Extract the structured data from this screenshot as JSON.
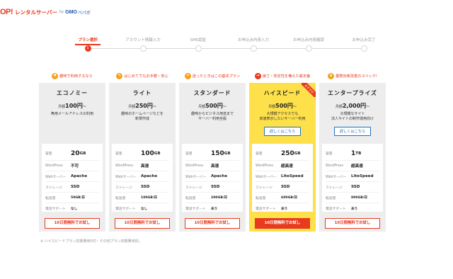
{
  "header": {
    "logo": "OP!",
    "name": "レンタルサーバー",
    "by": "by",
    "gmo": "GMO",
    "pepabo": "ペパボ"
  },
  "steps": [
    {
      "label": "プラン選択",
      "number": "1",
      "active": true
    },
    {
      "label": "アカウント情報入力",
      "number": "",
      "active": false
    },
    {
      "label": "SMS認証",
      "number": "",
      "active": false
    },
    {
      "label": "お申込み内容入力",
      "number": "",
      "active": false
    },
    {
      "label": "お申込み内容確認",
      "number": "",
      "active": false
    },
    {
      "label": "お申込み完了",
      "number": "",
      "active": false
    }
  ],
  "spec_labels": {
    "capacity": "容量",
    "wordpress": "WordPress",
    "webserver": "Webサーバー",
    "storage": "ストレージ",
    "transfer": "転送量",
    "support": "電話サポート"
  },
  "plans": [
    {
      "tagline": "趣味で利用するなら",
      "tag_icon": "¥",
      "name": "エコノミー",
      "price_prefix": "月額",
      "price": "100円",
      "price_suffix": "〜",
      "desc": "無用メールアドレスの利用",
      "capacity_num": "20",
      "capacity_unit": "GB",
      "wordpress": "不可",
      "webserver": "Apache",
      "storage": "SSD",
      "transfer": "50GB/日",
      "support": "なし",
      "trial": "10日間無料でお試し"
    },
    {
      "tagline": "はじめてでもお手軽・安心",
      "tag_icon": "✎",
      "name": "ライト",
      "price_prefix": "月額",
      "price": "250円",
      "price_suffix": "〜",
      "desc": "趣味のホームページなどを\n新規作成",
      "capacity_num": "100",
      "capacity_unit": "GB",
      "wordpress": "高速",
      "webserver": "Apache",
      "storage": "SSD",
      "transfer": "100GB/日",
      "support": "なし",
      "trial": "10日間無料でお試し"
    },
    {
      "tagline": "迷ったときはこの基本プラン",
      "tag_icon": "✦",
      "name": "スタンダード",
      "price_prefix": "月額",
      "price": "500円",
      "price_suffix": "〜",
      "desc": "趣味からビジネス用途まで\nサーバー利用全般",
      "capacity_num": "150",
      "capacity_unit": "GB",
      "wordpress": "高速",
      "webserver": "Apache",
      "storage": "SSD",
      "transfer": "200GB/日",
      "support": "あり",
      "trial": "10日間無料でお試し"
    },
    {
      "tagline": "速さ・安定性を備えた最定番",
      "tag_icon": "➜",
      "name": "ハイスピード",
      "price_prefix": "月額",
      "price": "500円",
      "price_suffix": "〜",
      "desc": "大規模アクセスでも\n高速表示したいサーバー利用",
      "detail": "詳しくはこちら",
      "ribbon": "おすすめ",
      "capacity_num": "250",
      "capacity_unit": "GB",
      "wordpress": "超高速",
      "webserver": "LiteSpeed",
      "storage": "SSD",
      "transfer": "600GB/日",
      "support": "あり",
      "trial": "10日間無料でお試し"
    },
    {
      "tagline": "業務効率改善のスペック!",
      "tag_icon": "♛",
      "name": "エンタープライズ",
      "price_prefix": "月額",
      "price": "2,000円",
      "price_suffix": "〜",
      "desc": "大規模なサイト\n法人サイトの制作運用向け",
      "detail": "詳しくはこちら",
      "capacity_num": "1",
      "capacity_unit": "TB",
      "wordpress": "超高速",
      "webserver": "LiteSpeed",
      "storage": "SSD",
      "transfer": "800GB/日",
      "support": "あり",
      "trial": "10日間無料でお試し"
    }
  ],
  "footnote": "※ ハイスピードプラン初期費用0円・その他プラン初期費用別。",
  "colors": {
    "accent": "#e83a1e",
    "highlight": "#fde04a",
    "card": "#ededed",
    "link": "#1a6fc9"
  }
}
